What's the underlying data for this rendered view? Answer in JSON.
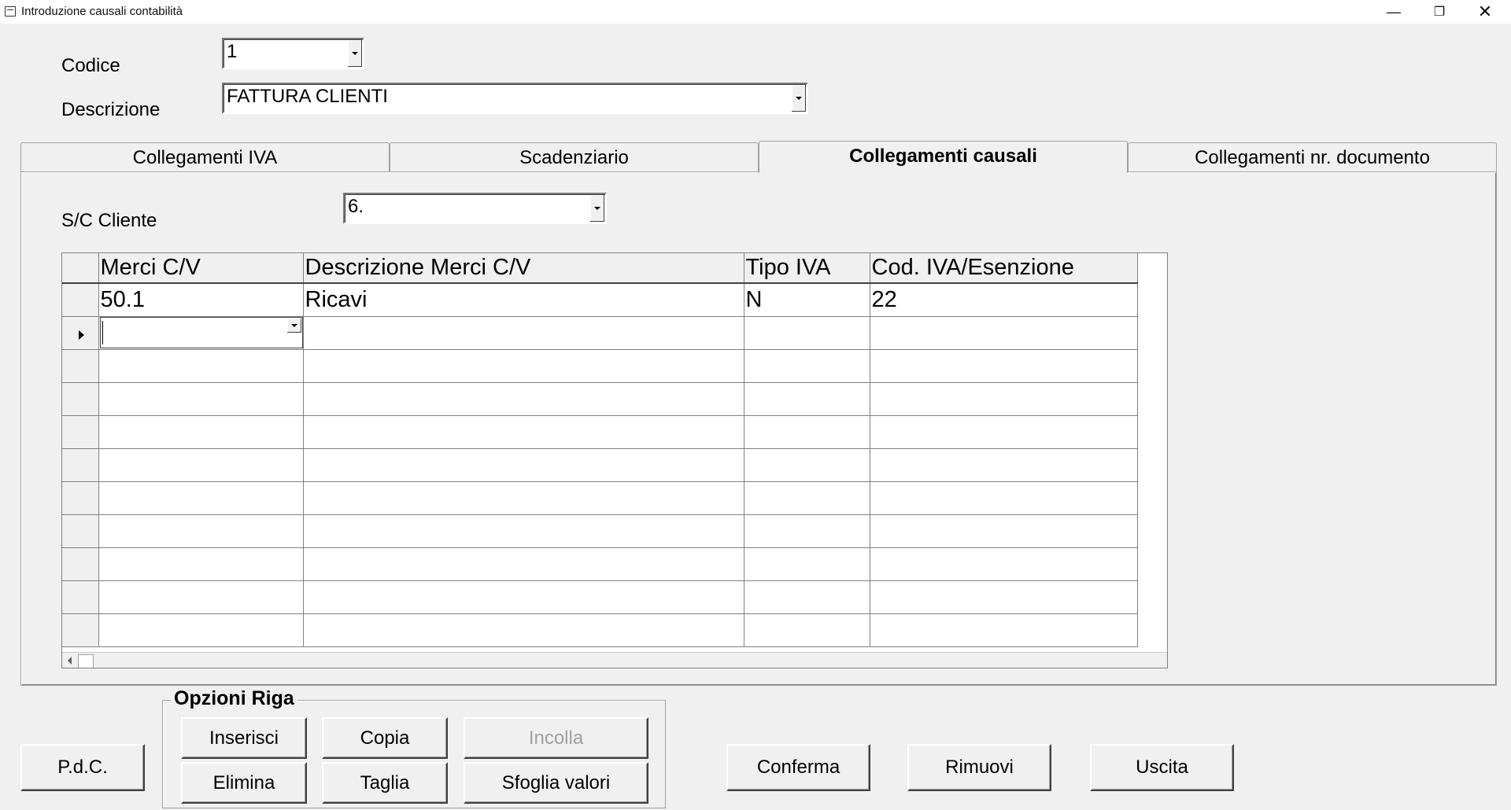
{
  "window": {
    "title": "Introduzione causali contabilità",
    "controls": [
      "minimize-icon",
      "restore-icon",
      "close-icon"
    ]
  },
  "form": {
    "codice_label": "Codice",
    "codice_value": "1",
    "descrizione_label": "Descrizione",
    "descrizione_value": "FATTURA CLIENTI"
  },
  "tabs": [
    {
      "label": "Collegamenti IVA",
      "active": false
    },
    {
      "label": "Scadenziario",
      "active": false
    },
    {
      "label": "Collegamenti causali",
      "active": true
    },
    {
      "label": "Collegamenti nr. documento",
      "active": false
    }
  ],
  "panel": {
    "sc_cliente_label": "S/C Cliente",
    "sc_cliente_value": "6."
  },
  "grid": {
    "columns": [
      "Merci C/V",
      "Descrizione Merci C/V",
      "Tipo IVA",
      "Cod. IVA/Esenzione"
    ],
    "rows": [
      [
        "50.1",
        "Ricavi",
        "N",
        "22"
      ]
    ]
  },
  "row_options": {
    "title": "Opzioni Riga",
    "insert": "Inserisci",
    "copy": "Copia",
    "paste": "Incolla",
    "delete": "Elimina",
    "cut": "Taglia",
    "browse": "Sfoglia valori"
  },
  "buttons": {
    "pdc": "P.d.C.",
    "confirm": "Conferma",
    "remove": "Rimuovi",
    "exit": "Uscita"
  }
}
